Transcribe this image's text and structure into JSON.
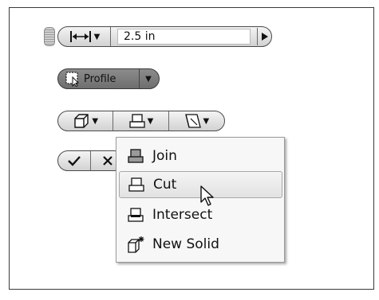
{
  "dimension": {
    "value": "2.5 in"
  },
  "profile": {
    "label": "Profile"
  },
  "operation_menu": {
    "items": [
      {
        "label": "Join",
        "icon": "join-icon"
      },
      {
        "label": "Cut",
        "icon": "cut-icon",
        "hovered": true
      },
      {
        "label": "Intersect",
        "icon": "intersect-icon"
      },
      {
        "label": "New Solid",
        "icon": "new-solid-icon"
      }
    ]
  }
}
